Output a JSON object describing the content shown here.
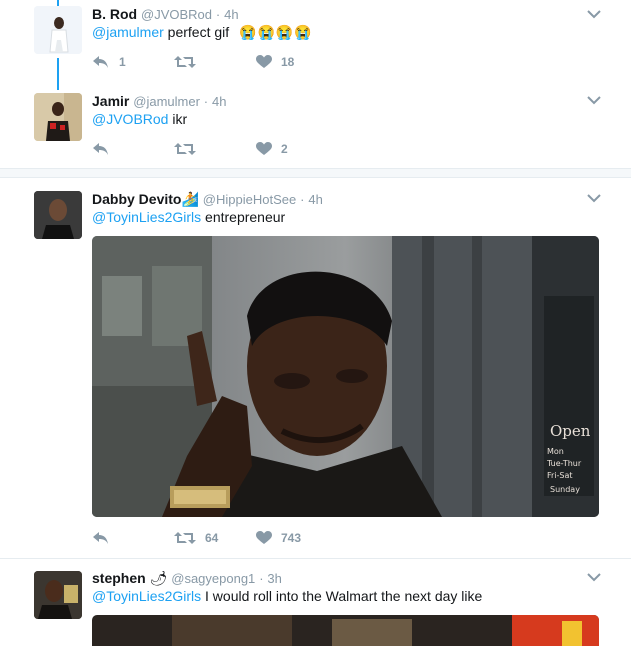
{
  "tweets": [
    {
      "name": "B. Rod",
      "handle": "@JVOBRod",
      "dot": "·",
      "time": "4h",
      "mention": "@jamulmer",
      "text": " perfect gif",
      "emoji": "😭😭😭😭",
      "replies": "1",
      "retweets": "",
      "likes": "18"
    },
    {
      "name": "Jamir",
      "handle": "@jamulmer",
      "dot": "·",
      "time": "4h",
      "mention": "@JVOBRod",
      "text": " ikr",
      "replies": "",
      "retweets": "",
      "likes": "2"
    },
    {
      "name": "Dabby Devito",
      "name_emoji": "🏄",
      "handle": "@HippieHotSee",
      "dot": "·",
      "time": "4h",
      "mention": "@ToyinLies2Girls",
      "text": " entrepreneur",
      "sign_text": [
        "Open",
        "Mon",
        "Tue-Thur",
        "Fri-Sat",
        "Sunday"
      ],
      "replies": "",
      "retweets": "64",
      "likes": "743"
    },
    {
      "name": "stephen",
      "name_emoji": "🌶",
      "handle": "@sagyepong1",
      "dot": "·",
      "time": "3h",
      "mention": "@ToyinLies2Girls",
      "text": " I would roll into the Walmart the next day like"
    }
  ],
  "icons": [
    "reply-icon",
    "retweet-icon",
    "heart-icon",
    "chevron-down-icon"
  ],
  "colors": {
    "accent": "#1da1f2",
    "muted": "#8899a6",
    "text": "#14171a",
    "divider": "#e6ecf0"
  }
}
